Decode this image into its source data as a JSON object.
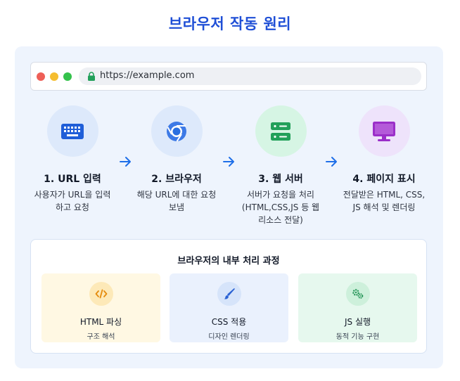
{
  "title": "브라우저 작동 원리",
  "browser": {
    "url": "https://example.com"
  },
  "steps": [
    {
      "title": "1. URL 입력",
      "desc": [
        "사용자가 URL을 입력",
        "하고 요청"
      ],
      "icon": "keyboard-icon",
      "bg": "#dde9fb",
      "fg": "#1f5ed8"
    },
    {
      "title": "2. 브라우저",
      "desc": [
        "해당 URL에 대한 요청",
        "보냄"
      ],
      "icon": "chrome-icon",
      "bg": "#dde9fb",
      "fg": "#2a6fe0"
    },
    {
      "title": "3. 웹 서버",
      "desc": [
        "서버가 요청을 처리",
        "(HTML,CSS,JS 등 웹",
        "리소스 전달)"
      ],
      "icon": "server-icon",
      "bg": "#d6f5e4",
      "fg": "#22a05a"
    },
    {
      "title": "4. 페이지 표시",
      "desc": [
        "전달받은 HTML, CSS,",
        "JS 해석 및 렌더링"
      ],
      "icon": "monitor-icon",
      "bg": "#eee3fb",
      "fg": "#9b2fc9"
    }
  ],
  "process": {
    "title": "브라우저의 내부 처리 과정",
    "cards": [
      {
        "title": "HTML 파싱",
        "desc": "구조 해석",
        "icon": "code-icon",
        "bg": "#fff8e3",
        "iconbg": "#fde9b8",
        "fg": "#e58b0c"
      },
      {
        "title": "CSS 적용",
        "desc": "디자인 렌더링",
        "icon": "brush-icon",
        "bg": "#eaf1fd",
        "iconbg": "#d6e4fa",
        "fg": "#2b63d4"
      },
      {
        "title": "JS 실행",
        "desc": "동적 기능 구현",
        "icon": "gears-icon",
        "bg": "#e6f8ee",
        "iconbg": "#cdf0db",
        "fg": "#239456"
      }
    ]
  },
  "colors": {
    "accent": "#1f4fd6",
    "arrow": "#1f6fe8",
    "panel": "#eef4fd"
  }
}
